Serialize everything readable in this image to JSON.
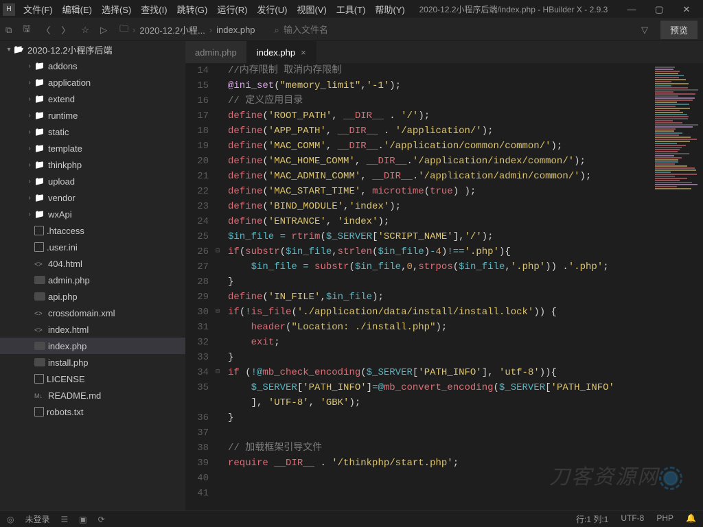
{
  "app": {
    "logo": "H",
    "title": "2020-12.2小程序后端/index.php - HBuilder X - 2.9.3"
  },
  "menus": [
    "文件(F)",
    "编辑(E)",
    "选择(S)",
    "查找(I)",
    "跳转(G)",
    "运行(R)",
    "发行(U)",
    "视图(V)",
    "工具(T)",
    "帮助(Y)"
  ],
  "toolbar": {
    "breadcrumb": [
      "2020-12.2小程...",
      "index.php"
    ],
    "search_placeholder": "输入文件名",
    "preview": "预览"
  },
  "tree": {
    "root": "2020-12.2小程序后端",
    "items": [
      {
        "name": "addons",
        "type": "folder",
        "depth": 1
      },
      {
        "name": "application",
        "type": "folder",
        "depth": 1
      },
      {
        "name": "extend",
        "type": "folder",
        "depth": 1
      },
      {
        "name": "runtime",
        "type": "folder",
        "depth": 1
      },
      {
        "name": "static",
        "type": "folder",
        "depth": 1
      },
      {
        "name": "template",
        "type": "folder",
        "depth": 1
      },
      {
        "name": "thinkphp",
        "type": "folder",
        "depth": 1
      },
      {
        "name": "upload",
        "type": "folder",
        "depth": 1
      },
      {
        "name": "vendor",
        "type": "folder",
        "depth": 1
      },
      {
        "name": "wxApi",
        "type": "folder",
        "depth": 1
      },
      {
        "name": ".htaccess",
        "type": "file",
        "icon": "file",
        "depth": 1
      },
      {
        "name": ".user.ini",
        "type": "file",
        "icon": "file",
        "depth": 1
      },
      {
        "name": "404.html",
        "type": "file",
        "icon": "code",
        "depth": 1
      },
      {
        "name": "admin.php",
        "type": "file",
        "icon": "php",
        "depth": 1
      },
      {
        "name": "api.php",
        "type": "file",
        "icon": "php",
        "depth": 1
      },
      {
        "name": "crossdomain.xml",
        "type": "file",
        "icon": "code",
        "depth": 1
      },
      {
        "name": "index.html",
        "type": "file",
        "icon": "code",
        "depth": 1
      },
      {
        "name": "index.php",
        "type": "file",
        "icon": "php",
        "depth": 1,
        "selected": true
      },
      {
        "name": "install.php",
        "type": "file",
        "icon": "php",
        "depth": 1
      },
      {
        "name": "LICENSE",
        "type": "file",
        "icon": "file",
        "depth": 1
      },
      {
        "name": "README.md",
        "type": "file",
        "icon": "md",
        "depth": 1
      },
      {
        "name": "robots.txt",
        "type": "file",
        "icon": "file",
        "depth": 1
      }
    ]
  },
  "tabs": [
    {
      "label": "admin.php",
      "active": false
    },
    {
      "label": "index.php",
      "active": true
    }
  ],
  "code": [
    {
      "n": 14,
      "html": "<span class='c-comment'>//内存限制 取消内存限制</span>"
    },
    {
      "n": 15,
      "html": "<span class='c-at'>@ini_set</span><span class='c-paren'>(</span><span class='c-str'>\"memory_limit\"</span><span class='c-punct'>,</span><span class='c-str'>'-1'</span><span class='c-paren'>)</span><span class='c-punct'>;</span>"
    },
    {
      "n": 16,
      "html": "<span class='c-comment'>// 定义应用目录</span>"
    },
    {
      "n": 17,
      "html": "<span class='c-func'>define</span><span class='c-paren'>(</span><span class='c-str'>'ROOT_PATH'</span><span class='c-punct'>, </span><span class='c-const'>__DIR__</span> <span class='c-punct'>. </span><span class='c-str'>'/'</span><span class='c-paren'>)</span><span class='c-punct'>;</span>"
    },
    {
      "n": 18,
      "html": "<span class='c-func'>define</span><span class='c-paren'>(</span><span class='c-str'>'APP_PATH'</span><span class='c-punct'>, </span><span class='c-const'>__DIR__</span> <span class='c-punct'>. </span><span class='c-str'>'/application/'</span><span class='c-paren'>)</span><span class='c-punct'>;</span>"
    },
    {
      "n": 19,
      "html": "<span class='c-func'>define</span><span class='c-paren'>(</span><span class='c-str'>'MAC_COMM'</span><span class='c-punct'>, </span><span class='c-const'>__DIR__</span><span class='c-punct'>.</span><span class='c-str'>'/application/common/common/'</span><span class='c-paren'>)</span><span class='c-punct'>;</span>"
    },
    {
      "n": 20,
      "html": "<span class='c-func'>define</span><span class='c-paren'>(</span><span class='c-str'>'MAC_HOME_COMM'</span><span class='c-punct'>, </span><span class='c-const'>__DIR__</span><span class='c-punct'>.</span><span class='c-str'>'/application/index/common/'</span><span class='c-paren'>)</span><span class='c-punct'>;</span>"
    },
    {
      "n": 21,
      "html": "<span class='c-func'>define</span><span class='c-paren'>(</span><span class='c-str'>'MAC_ADMIN_COMM'</span><span class='c-punct'>, </span><span class='c-const'>__DIR__</span><span class='c-punct'>.</span><span class='c-str'>'/application/admin/common/'</span><span class='c-paren'>)</span><span class='c-punct'>;</span>"
    },
    {
      "n": 22,
      "html": "<span class='c-func'>define</span><span class='c-paren'>(</span><span class='c-str'>'MAC_START_TIME'</span><span class='c-punct'>, </span><span class='c-func'>microtime</span><span class='c-paren'>(</span><span class='c-key'>true</span><span class='c-paren'>)</span> <span class='c-paren'>)</span><span class='c-punct'>;</span>"
    },
    {
      "n": 23,
      "html": "<span class='c-func'>define</span><span class='c-paren'>(</span><span class='c-str'>'BIND_MODULE'</span><span class='c-punct'>,</span><span class='c-str'>'index'</span><span class='c-paren'>)</span><span class='c-punct'>;</span>"
    },
    {
      "n": 24,
      "html": "<span class='c-func'>define</span><span class='c-paren'>(</span><span class='c-str'>'ENTRANCE'</span><span class='c-punct'>, </span><span class='c-str'>'index'</span><span class='c-paren'>)</span><span class='c-punct'>;</span>"
    },
    {
      "n": 25,
      "html": "<span class='c-var'>$in_file</span> <span class='c-op'>=</span> <span class='c-func'>rtrim</span><span class='c-paren'>(</span><span class='c-var'>$_SERVER</span><span class='c-paren'>[</span><span class='c-str'>'SCRIPT_NAME'</span><span class='c-paren'>]</span><span class='c-punct'>,</span><span class='c-str'>'/'</span><span class='c-paren'>)</span><span class='c-punct'>;</span>"
    },
    {
      "n": 26,
      "fold": "⊟",
      "html": "<span class='c-key'>if</span><span class='c-paren'>(</span><span class='c-func'>substr</span><span class='c-paren'>(</span><span class='c-var'>$in_file</span><span class='c-punct'>,</span><span class='c-func'>strlen</span><span class='c-paren'>(</span><span class='c-var'>$in_file</span><span class='c-paren'>)</span><span class='c-op'>-</span><span class='c-num'>4</span><span class='c-paren'>)</span><span class='c-op'>!==</span><span class='c-str'>'.php'</span><span class='c-paren'>){</span>"
    },
    {
      "n": 27,
      "html": "    <span class='c-var'>$in_file</span> <span class='c-op'>=</span> <span class='c-func'>substr</span><span class='c-paren'>(</span><span class='c-var'>$in_file</span><span class='c-punct'>,</span><span class='c-num'>0</span><span class='c-punct'>,</span><span class='c-func'>strpos</span><span class='c-paren'>(</span><span class='c-var'>$in_file</span><span class='c-punct'>,</span><span class='c-str'>'.php'</span><span class='c-paren'>))</span> <span class='c-punct'>.</span><span class='c-str'>'.php'</span><span class='c-punct'>;</span>"
    },
    {
      "n": 28,
      "html": "<span class='c-paren'>}</span>"
    },
    {
      "n": 29,
      "html": "<span class='c-func'>define</span><span class='c-paren'>(</span><span class='c-str'>'IN_FILE'</span><span class='c-punct'>,</span><span class='c-var'>$in_file</span><span class='c-paren'>)</span><span class='c-punct'>;</span>"
    },
    {
      "n": 30,
      "fold": "⊟",
      "html": "<span class='c-key'>if</span><span class='c-paren'>(</span><span class='c-op'>!</span><span class='c-func'>is_file</span><span class='c-paren'>(</span><span class='c-str'>'./application/data/install/install.lock'</span><span class='c-paren'>))</span> <span class='c-paren'>{</span>"
    },
    {
      "n": 31,
      "html": "    <span class='c-func'>header</span><span class='c-paren'>(</span><span class='c-str'>\"Location: ./install.php\"</span><span class='c-paren'>)</span><span class='c-punct'>;</span>"
    },
    {
      "n": 32,
      "html": "    <span class='c-key'>exit</span><span class='c-punct'>;</span>"
    },
    {
      "n": 33,
      "html": "<span class='c-paren'>}</span>"
    },
    {
      "n": 34,
      "fold": "⊟",
      "html": "<span class='c-key'>if</span> <span class='c-paren'>(</span><span class='c-op'>!@</span><span class='c-func'>mb_check_encoding</span><span class='c-paren'>(</span><span class='c-var'>$_SERVER</span><span class='c-paren'>[</span><span class='c-str'>'PATH_INFO'</span><span class='c-paren'>]</span><span class='c-punct'>, </span><span class='c-str'>'utf-8'</span><span class='c-paren'>)){</span>"
    },
    {
      "n": 35,
      "html": "    <span class='c-var'>$_SERVER</span><span class='c-paren'>[</span><span class='c-str'>'PATH_INFO'</span><span class='c-paren'>]</span><span class='c-op'>=@</span><span class='c-func'>mb_convert_encoding</span><span class='c-paren'>(</span><span class='c-var'>$_SERVER</span><span class='c-paren'>[</span><span class='c-str'>'PATH_INFO'</span>"
    },
    {
      "n": "",
      "html": "    <span class='c-paren'>]</span><span class='c-punct'>, </span><span class='c-str'>'UTF-8'</span><span class='c-punct'>, </span><span class='c-str'>'GBK'</span><span class='c-paren'>)</span><span class='c-punct'>;</span>"
    },
    {
      "n": 36,
      "html": "<span class='c-paren'>}</span>"
    },
    {
      "n": 37,
      "html": ""
    },
    {
      "n": 38,
      "html": "<span class='c-comment'>// 加载框架引导文件</span>"
    },
    {
      "n": 39,
      "html": "<span class='c-key'>require</span> <span class='c-const'>__DIR__</span> <span class='c-punct'>. </span><span class='c-str'>'/thinkphp/start.php'</span><span class='c-punct'>;</span>"
    },
    {
      "n": 40,
      "html": ""
    },
    {
      "n": 41,
      "html": ""
    }
  ],
  "statusbar": {
    "login": "未登录",
    "cursor": "行:1  列:1",
    "encoding": "UTF-8",
    "lang": "PHP"
  },
  "watermark": "刀客资源网"
}
